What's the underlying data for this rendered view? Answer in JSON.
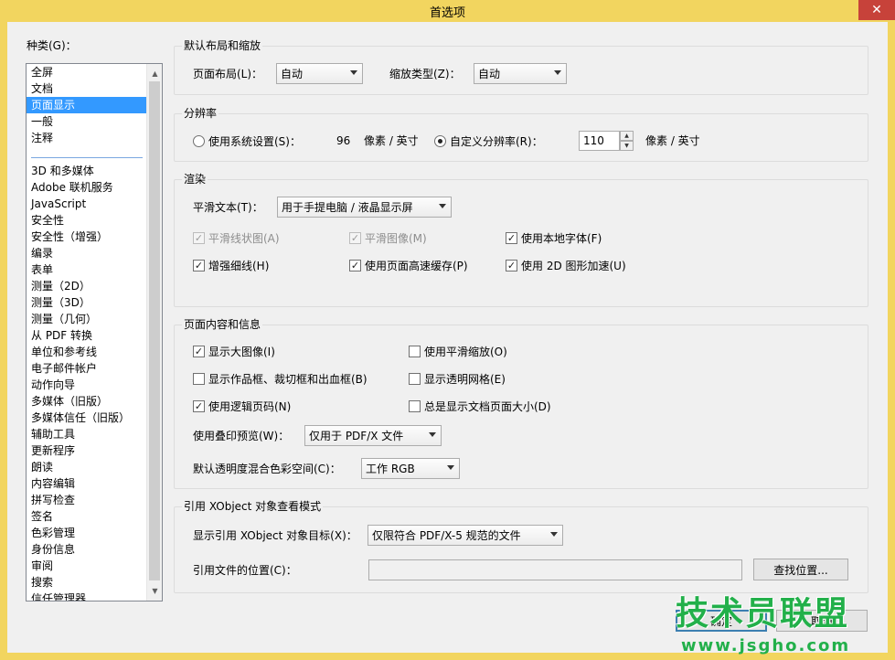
{
  "window": {
    "title": "首选项",
    "close_glyph": "✕"
  },
  "categories": {
    "label": "种类(G)：",
    "items": [
      "全屏",
      "文档",
      "页面显示",
      "一般",
      "注释",
      "",
      "3D 和多媒体",
      "Adobe 联机服务",
      "JavaScript",
      "安全性",
      "安全性（增强）",
      "编录",
      "表单",
      "测量（2D）",
      "测量（3D）",
      "测量（几何）",
      "从 PDF 转换",
      "单位和参考线",
      "电子邮件帐户",
      "动作向导",
      "多媒体（旧版）",
      "多媒体信任（旧版）",
      "辅助工具",
      "更新程序",
      "朗读",
      "内容编辑",
      "拼写检查",
      "签名",
      "色彩管理",
      "身份信息",
      "审阅",
      "搜索",
      "信任管理器"
    ],
    "selected": "页面显示"
  },
  "layout_group": {
    "title": "默认布局和缩放",
    "page_layout_label": "页面布局(L)：",
    "page_layout_value": "自动",
    "zoom_label": "缩放类型(Z)：",
    "zoom_value": "自动"
  },
  "resolution_group": {
    "title": "分辨率",
    "system_label": "使用系统设置(S)：",
    "system_value": "96",
    "system_unit": "像素 / 英寸",
    "custom_label": "自定义分辨率(R)：",
    "custom_value": "110",
    "custom_unit": "像素 / 英寸"
  },
  "render_group": {
    "title": "渲染",
    "smooth_text_label": "平滑文本(T)：",
    "smooth_text_value": "用于手提电脑 / 液晶显示屏",
    "smooth_lineart": "平滑线状图(A)",
    "smooth_images": "平滑图像(M)",
    "local_fonts": "使用本地字体(F)",
    "enhance_thin": "增强细线(H)",
    "page_cache": "使用页面高速缓存(P)",
    "gpu_2d": "使用 2D 图形加速(U)"
  },
  "content_group": {
    "title": "页面内容和信息",
    "large_images": "显示大图像(I)",
    "smooth_zoom": "使用平滑缩放(O)",
    "art_trim_bleed": "显示作品框、裁切框和出血框(B)",
    "transparency_grid": "显示透明网格(E)",
    "logical_page_numbers": "使用逻辑页码(N)",
    "always_show_size": "总是显示文档页面大小(D)",
    "overprint_label": "使用叠印预览(W)：",
    "overprint_value": "仅用于 PDF/X 文件",
    "blend_label": "默认透明度混合色彩空间(C)：",
    "blend_value": "工作 RGB"
  },
  "xobject_group": {
    "title": "引用 XObject 对象查看模式",
    "target_label": "显示引用 XObject 对象目标(X)：",
    "target_value": "仅限符合 PDF/X-5 规范的文件",
    "location_label": "引用文件的位置(C)：",
    "location_value": "",
    "browse_button": "查找位置..."
  },
  "footer": {
    "ok_button": "确定",
    "cancel_button": "取消"
  },
  "watermark": {
    "main": "技术员联盟",
    "url": "www.jsgho.com"
  },
  "colors": {
    "title_bar": "#f2d55f",
    "selection": "#3399ff",
    "close": "#c7423a",
    "watermark": "#22b04a"
  }
}
